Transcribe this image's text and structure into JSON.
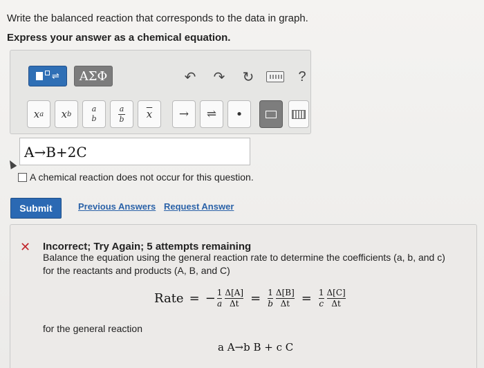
{
  "question": {
    "line1": "Write the balanced reaction that corresponds to the data in graph.",
    "line2": "Express your answer as a chemical equation."
  },
  "toolbar": {
    "greek_label": "ΑΣΦ",
    "help_label": "?",
    "keys": {
      "sup": "x",
      "sup_exp": "a",
      "sub": "x",
      "sub_idx": "b",
      "frac_num": "a",
      "frac_den": "b",
      "bar_char": "x",
      "arrow": "→",
      "eq": "⇌",
      "dot": "•"
    }
  },
  "answer": {
    "value": "A→B+2C"
  },
  "no_reaction_label": "A chemical reaction does not occur for this question.",
  "actions": {
    "submit": "Submit",
    "previous_answers": "Previous Answers",
    "request_answer": "Request Answer"
  },
  "feedback": {
    "title": "Incorrect; Try Again; 5 attempts remaining",
    "line1": "Balance the equation using the general reaction rate to determine the coefficients (a, b, and c)",
    "line2": "for the reactants and products (A, B, and C)",
    "rate_label": "Rate",
    "dA": "Δ[A]",
    "dB": "Δ[B]",
    "dC": "Δ[C]",
    "dt": "Δt",
    "general_label": "for the general reaction",
    "general_eq": "a A→b B + c C"
  }
}
